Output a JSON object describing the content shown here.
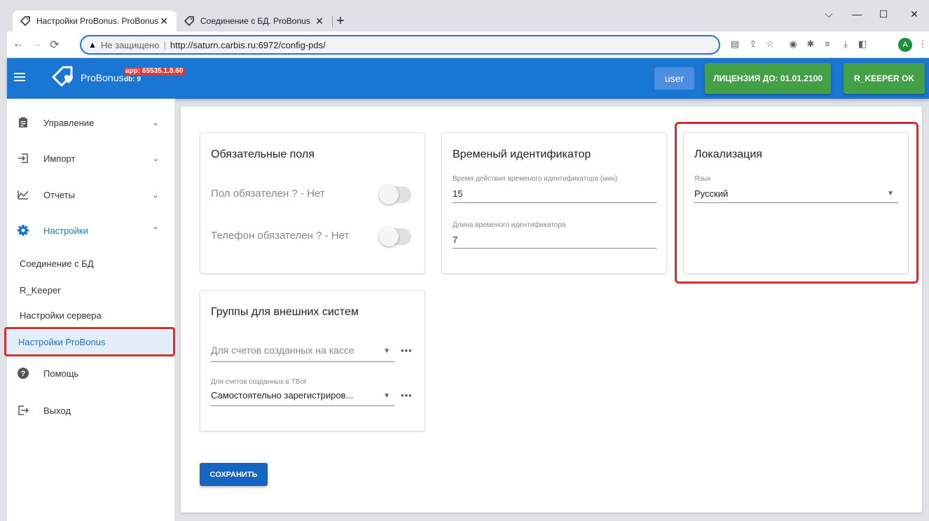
{
  "browser": {
    "tabs": [
      {
        "title": "Настройки ProBonus. ProBonus",
        "close": "✕"
      },
      {
        "title": "Соединение с БД. ProBonus",
        "close": "✕"
      }
    ],
    "new_tab": "+",
    "window_controls": {
      "dropdown": "⌵",
      "minimize": "—",
      "maximize": "☐",
      "close": "✕"
    },
    "security_text": "Не защищено",
    "url": "http://saturn.carbis.ru:6972/config-pds/",
    "profile_letter": "A"
  },
  "header": {
    "brand": "ProBonus",
    "app_version": "app: 65535.1.8.60",
    "db_version": "db: 9",
    "user_label": "user",
    "license_label": "ЛИЦЕНЗИЯ ДО: 01.01.2100",
    "rkeeper_label": "R_KEEPER OK",
    "accent_color": "#1976d2",
    "ok_color": "#43a047"
  },
  "sidebar": {
    "items": [
      {
        "label": "Управление",
        "icon": "clipboard-icon",
        "chevron": "⌄"
      },
      {
        "label": "Импорт",
        "icon": "import-icon",
        "chevron": "⌄"
      },
      {
        "label": "Отчеты",
        "icon": "chart-icon",
        "chevron": "⌄"
      },
      {
        "label": "Настройки",
        "icon": "gear-icon",
        "chevron": "⌃"
      }
    ],
    "sub_items": [
      {
        "label": "Соединение с БД"
      },
      {
        "label": "R_Keeper"
      },
      {
        "label": "Настройки сервера"
      },
      {
        "label": "Настройки ProBonus"
      }
    ],
    "bottom_items": [
      {
        "label": "Помощь",
        "icon": "help-icon"
      },
      {
        "label": "Выход",
        "icon": "logout-icon"
      }
    ]
  },
  "main": {
    "required_fields": {
      "title": "Обязательные поля",
      "gender_label": "Пол обязателен ? - Нет",
      "phone_label": "Телефон обязателен ? - Нет"
    },
    "temp_id": {
      "title": "Временый идентификатор",
      "duration_label": "Время действия временого идентификатора (мин)",
      "duration_value": "15",
      "length_label": "Длина временого идентификатора",
      "length_value": "7"
    },
    "localization": {
      "title": "Локализация",
      "language_label": "Язык",
      "language_value": "Русский"
    },
    "external_groups": {
      "title": "Группы для внешних систем",
      "cashier_placeholder": "Для счетов созданных на кассе",
      "tbot_label": "Для счетов созданных в TBot",
      "tbot_value": "Самостоятельно зарегистриров..."
    },
    "save_label": "СОХРАНИТЬ"
  }
}
